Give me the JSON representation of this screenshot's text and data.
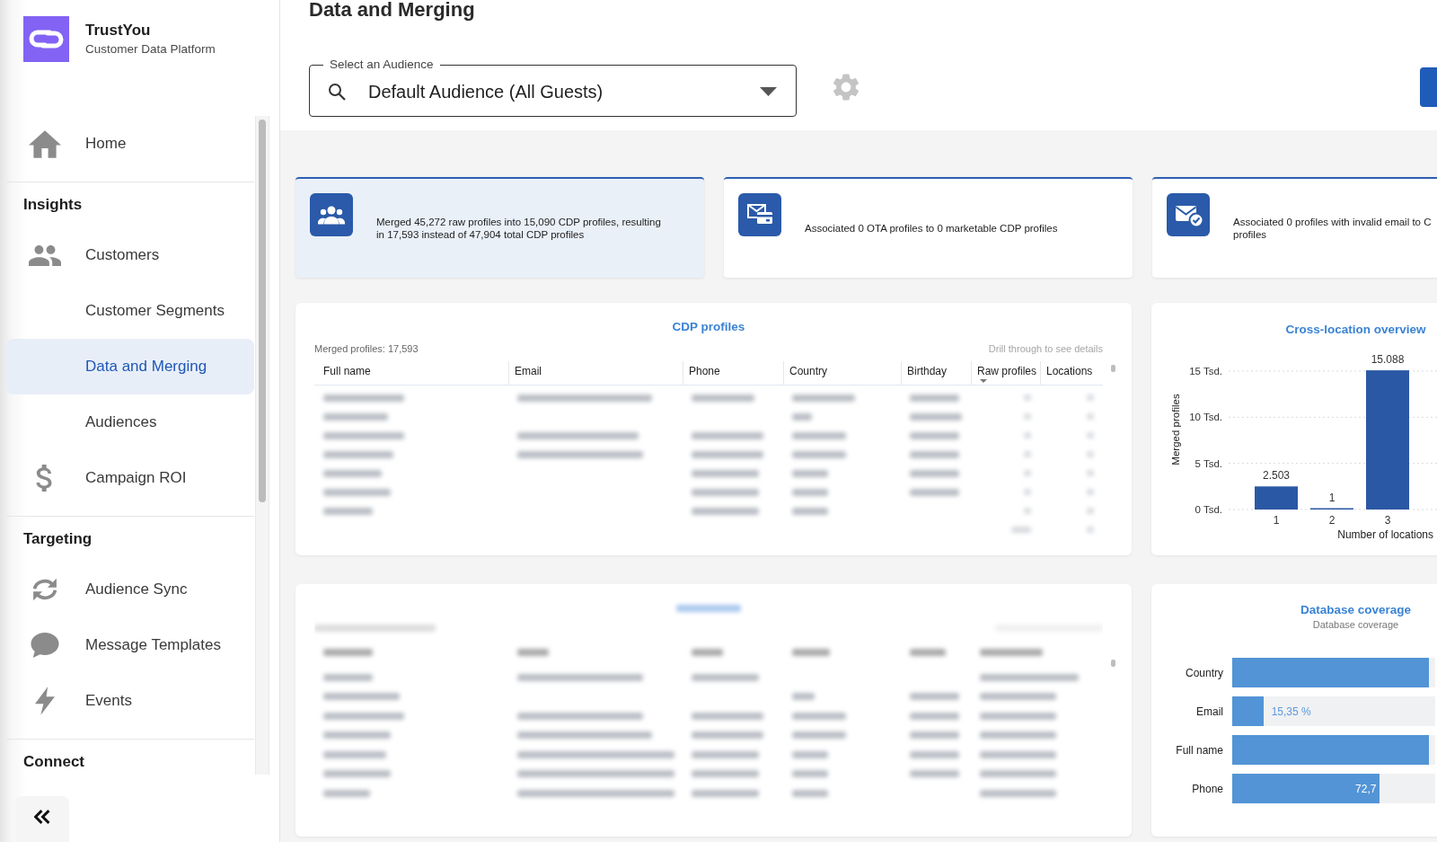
{
  "sidebar": {
    "brand": {
      "name": "TrustYou",
      "tagline": "Customer Data Platform"
    },
    "sections": [
      {
        "items": [
          {
            "label": "Home",
            "kind": "home",
            "selected": false
          }
        ]
      },
      {
        "title": "Insights",
        "items": [
          {
            "label": "Customers",
            "kind": "people",
            "selected": false
          },
          {
            "label": "Customer Segments",
            "kind": "plain",
            "selected": false
          },
          {
            "label": "Data and Merging",
            "kind": "plain",
            "selected": true
          },
          {
            "label": "Audiences",
            "kind": "plain",
            "selected": false
          },
          {
            "label": "Campaign ROI",
            "kind": "dollar",
            "selected": false
          }
        ]
      },
      {
        "title": "Targeting",
        "items": [
          {
            "label": "Audience Sync",
            "kind": "sync",
            "selected": false
          },
          {
            "label": "Message Templates",
            "kind": "chat",
            "selected": false
          },
          {
            "label": "Events",
            "kind": "bolt",
            "selected": false
          }
        ]
      },
      {
        "title": "Connect"
      }
    ]
  },
  "page_title": "Data and Merging",
  "audience_select": {
    "label": "Select an Audience",
    "value": "Default Audience (All Guests)"
  },
  "stat_cards": [
    {
      "kind": "merge",
      "selected": true,
      "lines": [
        "Merged 45,272 raw profiles into 15,090 CDP profiles, resulting",
        "in 17,593 instead of 47,904 total CDP profiles"
      ]
    },
    {
      "kind": "ota",
      "selected": false,
      "lines": [
        "Associated 0 OTA profiles to 0 marketable CDP profiles"
      ]
    },
    {
      "kind": "email",
      "selected": false,
      "lines": [
        "Associated 0 profiles with invalid email to C",
        "profiles"
      ]
    }
  ],
  "cdp_profiles": {
    "title": "CDP profiles",
    "summary": "Merged profiles: 17,593",
    "hint": "Drill through to see details",
    "columns": [
      {
        "label": "Full name",
        "sorted": false
      },
      {
        "label": "Email",
        "sorted": false
      },
      {
        "label": "Phone",
        "sorted": false
      },
      {
        "label": "Country",
        "sorted": false
      },
      {
        "label": "Birthday",
        "sorted": false
      },
      {
        "label": "Raw profiles",
        "sorted": true
      },
      {
        "label": "Locations",
        "sorted": false
      }
    ]
  },
  "cross_location": {
    "chart_data": {
      "type": "bar",
      "title": "Cross-location overview",
      "xlabel": "Number of locations",
      "ylabel": "Merged profiles",
      "categories": [
        "1",
        "2",
        "3"
      ],
      "values": [
        2.503,
        0.001,
        15.088
      ],
      "ylim": [
        0,
        15.088
      ],
      "grid": true,
      "yticks": [
        {
          "value": 0,
          "label": "0 Tsd."
        },
        {
          "value": 5,
          "label": "5 Tsd."
        },
        {
          "value": 10,
          "label": "10 Tsd."
        },
        {
          "value": 15,
          "label": "15 Tsd."
        }
      ]
    },
    "bar_labels": [
      "2.503",
      "1",
      "15.088"
    ]
  },
  "database_coverage": {
    "title": "Database coverage",
    "subtitle": "Database coverage",
    "rows": [
      {
        "label": "Country",
        "level": 0.97
      },
      {
        "label": "Email",
        "level": 0.1535,
        "reading": "15,35 %"
      },
      {
        "label": "Full name",
        "level": 0.97
      },
      {
        "label": "Phone",
        "level": 0.7274,
        "reading": "72,7"
      }
    ]
  }
}
